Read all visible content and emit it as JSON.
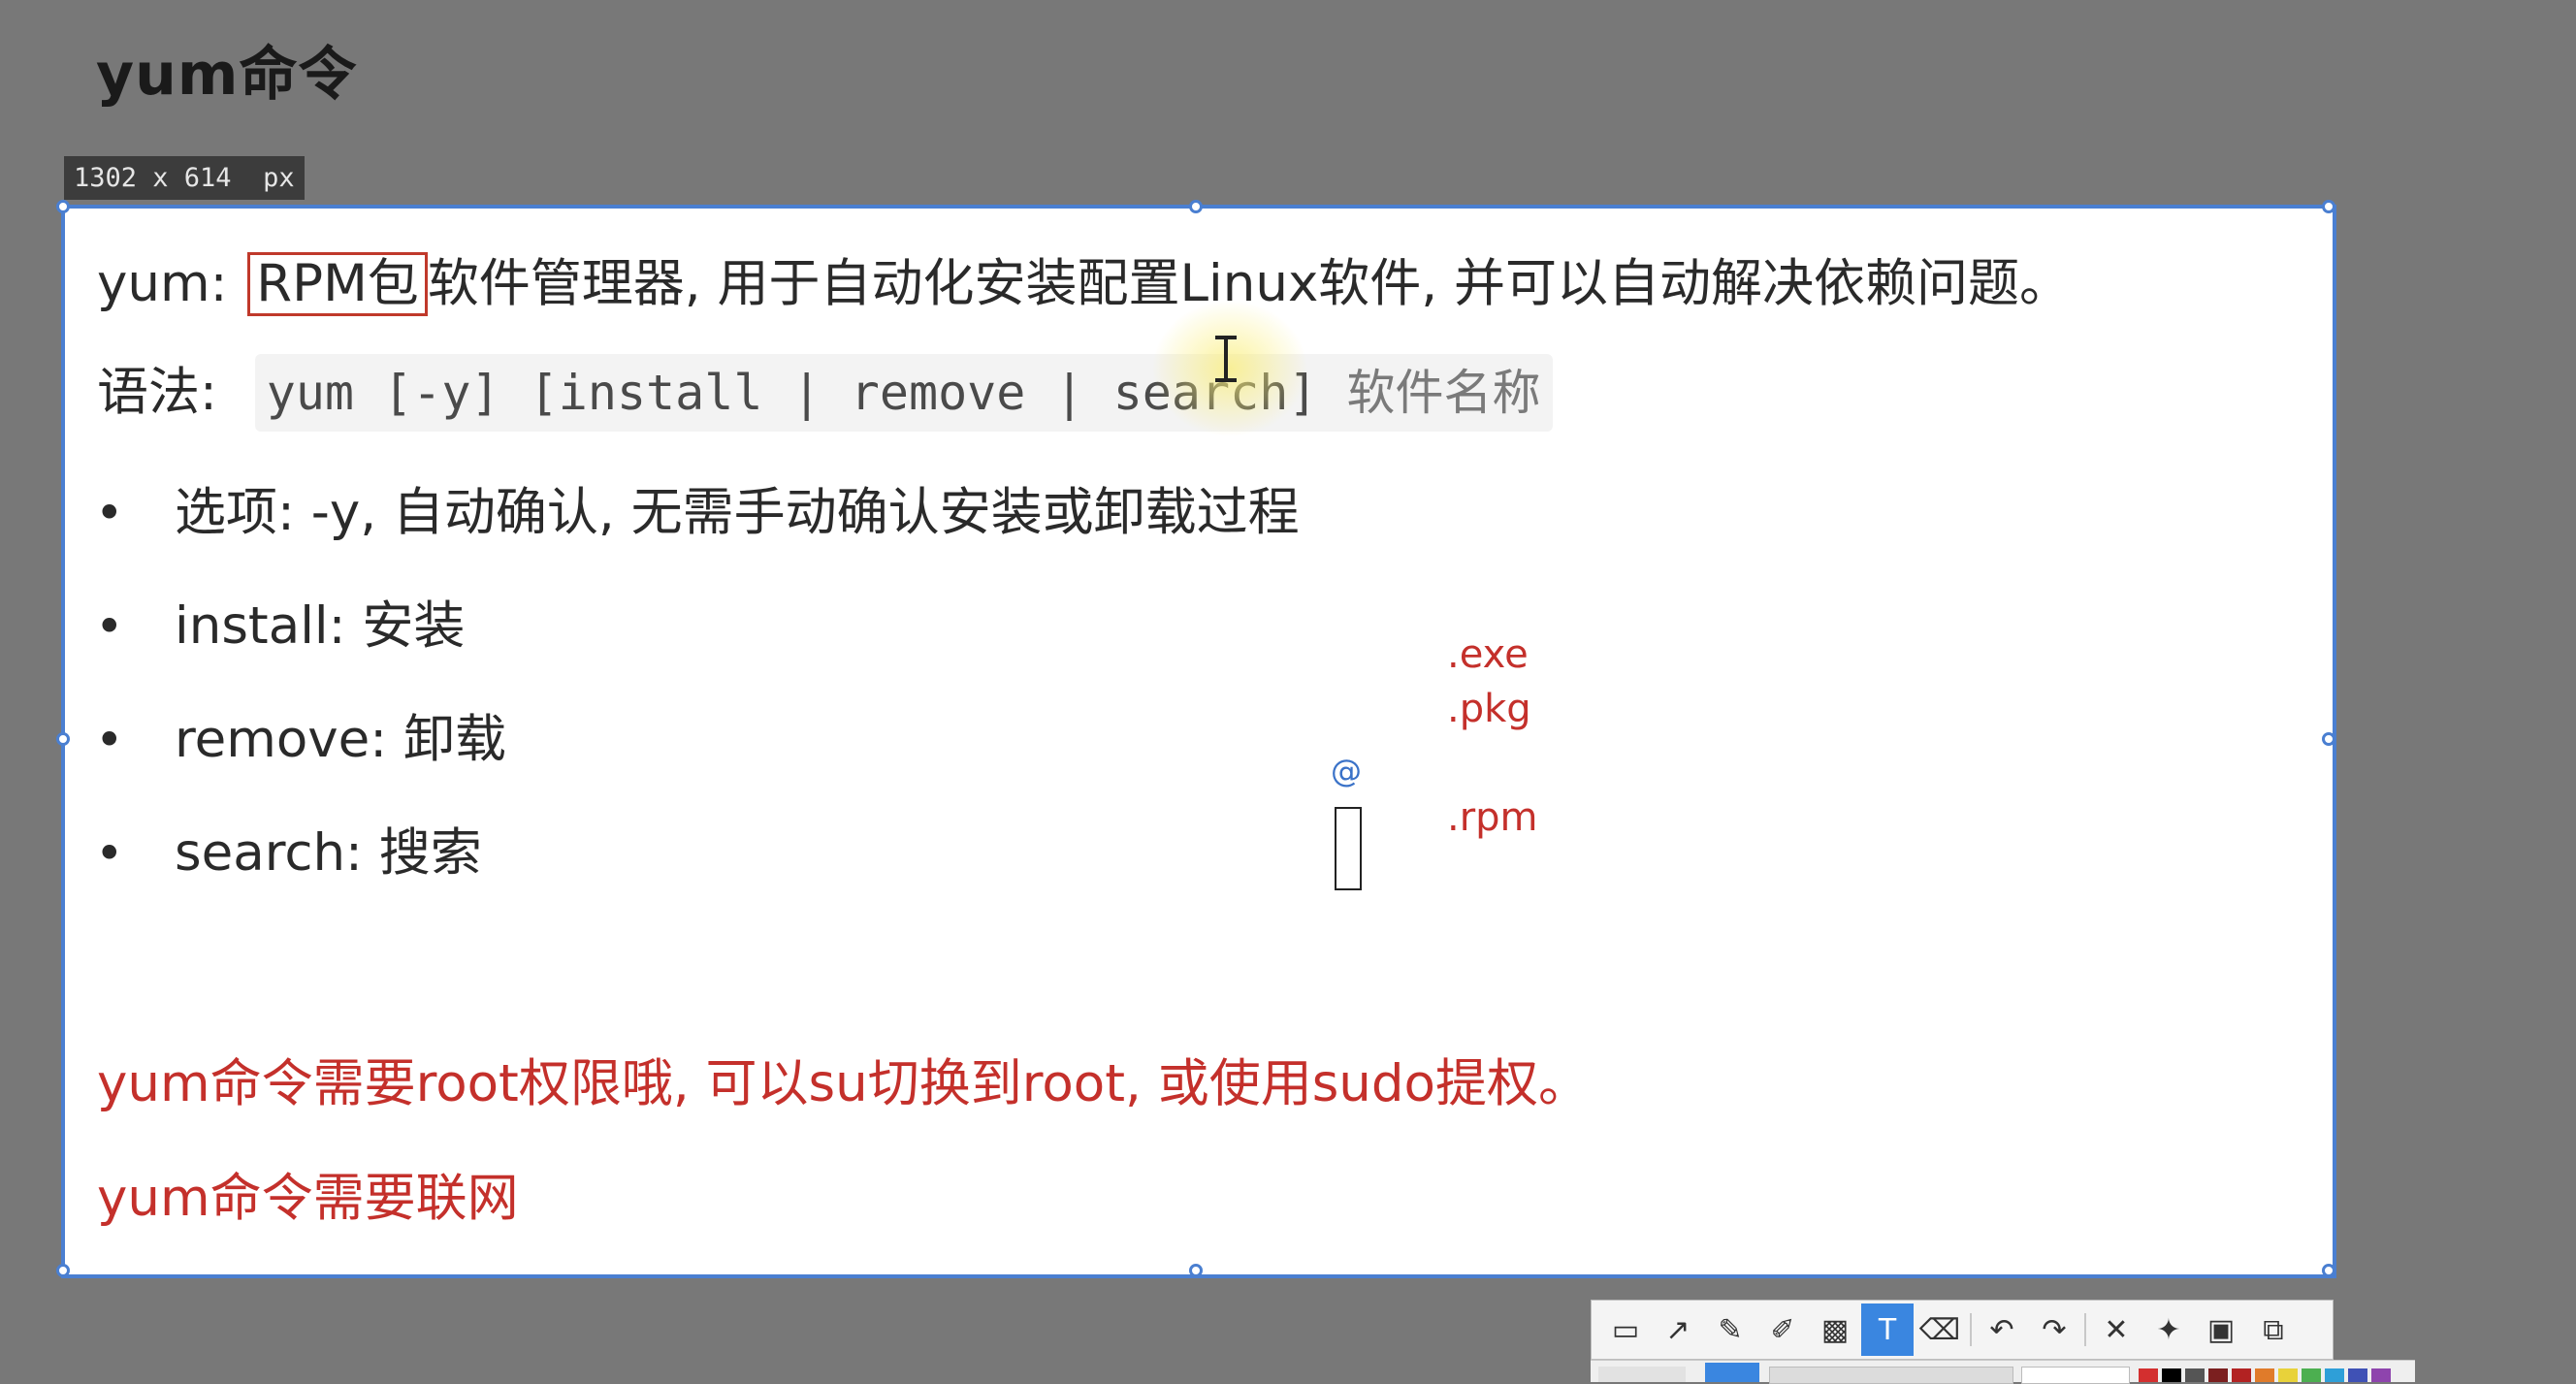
{
  "page": {
    "title": "yum命令",
    "size_readout": "1302 x 614  px"
  },
  "content": {
    "intro_prefix": "yum: ",
    "intro_boxed": "RPM包",
    "intro_rest": "软件管理器, 用于自动化安装配置Linux软件, 并可以自动解决依赖问题。",
    "syntax_label": "语法: ",
    "syntax_code": "yum [-y] [install | remove | search] ",
    "syntax_code_cn": "软件名称",
    "bullets": [
      {
        "text": "选项: -y, 自动确认, 无需手动确认安装或卸载过程"
      },
      {
        "text": "install: 安装"
      },
      {
        "text": "remove: 卸载"
      },
      {
        "text": "search: 搜索"
      }
    ],
    "note1": "yum命令需要root权限哦, 可以su切换到root, 或使用sudo提权。",
    "note2": "yum命令需要联网"
  },
  "annotations": {
    "ext_exe": ".exe",
    "ext_pkg": ".pkg",
    "ext_rpm": ".rpm"
  },
  "toolbar": {
    "tools": [
      {
        "name": "rectangle-tool",
        "glyph": "▭"
      },
      {
        "name": "arrow-tool",
        "glyph": "↗"
      },
      {
        "name": "pencil-tool",
        "glyph": "✎"
      },
      {
        "name": "marker-tool",
        "glyph": "✐"
      },
      {
        "name": "mosaic-tool",
        "glyph": "▩"
      },
      {
        "name": "text-tool",
        "glyph": "T",
        "active": true
      },
      {
        "name": "eraser-tool",
        "glyph": "⌫"
      },
      {
        "name": "undo",
        "glyph": "↶"
      },
      {
        "name": "redo",
        "glyph": "↷"
      },
      {
        "name": "close",
        "glyph": "✕"
      },
      {
        "name": "pin",
        "glyph": "📌"
      },
      {
        "name": "save",
        "glyph": "💾"
      },
      {
        "name": "copy",
        "glyph": "⧉"
      }
    ]
  },
  "colors": {
    "accent": "#4a7fd1",
    "note_red": "#c4302b",
    "palette": [
      "#d32f2f",
      "#000000",
      "#555555",
      "#7b1f1f",
      "#b22222",
      "#e07b2a",
      "#e8d23a",
      "#4caf50",
      "#2e9fd8",
      "#3f51b5",
      "#8e44ad"
    ]
  }
}
